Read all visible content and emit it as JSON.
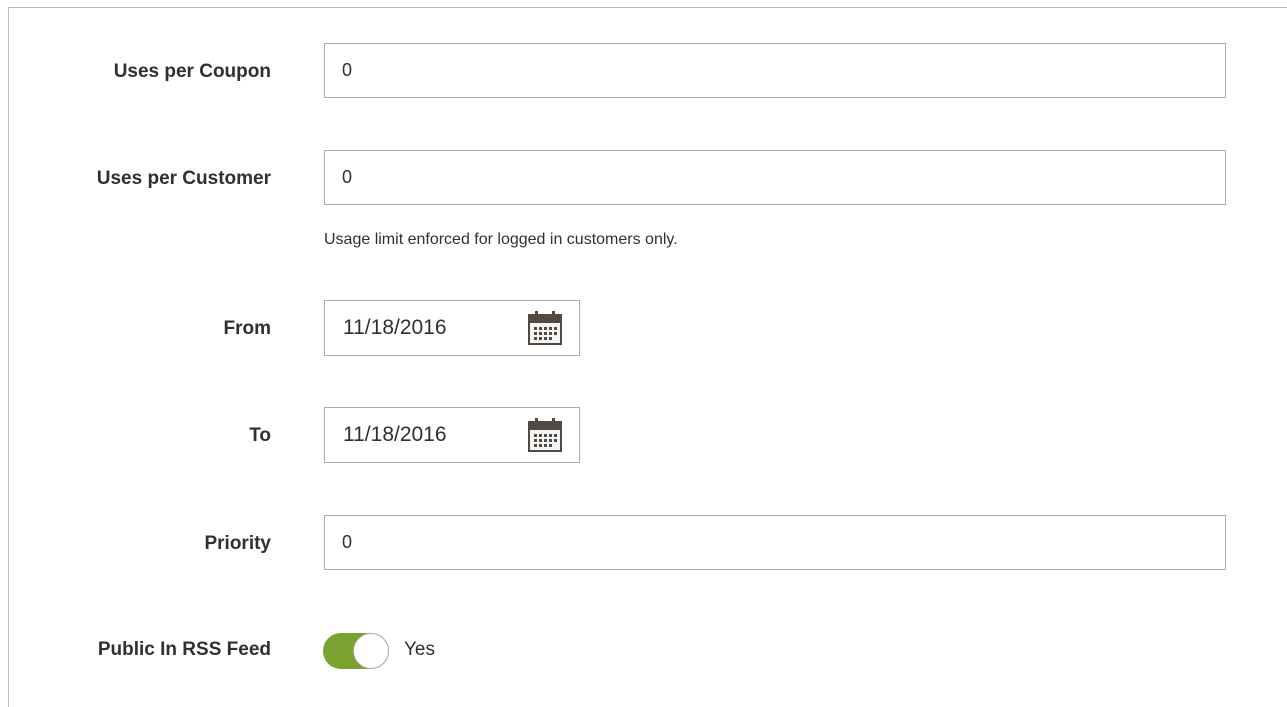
{
  "form": {
    "uses_per_coupon": {
      "label": "Uses per Coupon",
      "value": "0"
    },
    "uses_per_customer": {
      "label": "Uses per Customer",
      "value": "0",
      "note": "Usage limit enforced for logged in customers only."
    },
    "from": {
      "label": "From",
      "value": "11/18/2016",
      "icon": "calendar-icon"
    },
    "to": {
      "label": "To",
      "value": "11/18/2016",
      "icon": "calendar-icon"
    },
    "priority": {
      "label": "Priority",
      "value": "0"
    },
    "public_in_rss_feed": {
      "label": "Public In RSS Feed",
      "state": "on",
      "state_label": "Yes",
      "toggle_color": "#79a22e"
    }
  }
}
